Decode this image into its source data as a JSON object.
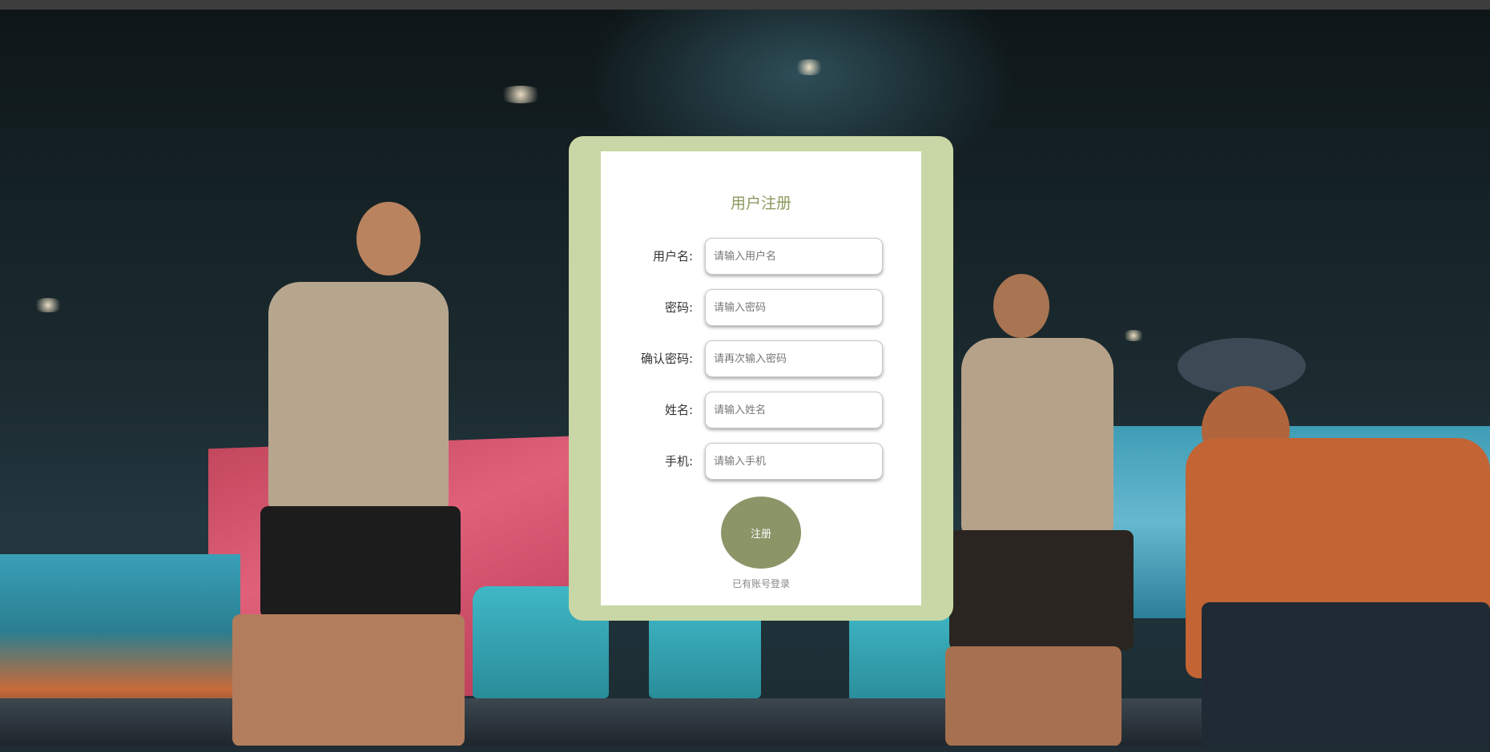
{
  "register": {
    "title": "用户注册",
    "fields": [
      {
        "label": "用户名:",
        "placeholder": "请输入用户名",
        "value": ""
      },
      {
        "label": "密码:",
        "placeholder": "请输入密码",
        "value": ""
      },
      {
        "label": "确认密码:",
        "placeholder": "请再次输入密码",
        "value": ""
      },
      {
        "label": "姓名:",
        "placeholder": "请输入姓名",
        "value": ""
      },
      {
        "label": "手机:",
        "placeholder": "请输入手机",
        "value": ""
      }
    ],
    "submit_label": "注册",
    "login_link": "已有账号登录"
  },
  "colors": {
    "frame": "#c8d7a5",
    "title": "#8a9a5f",
    "button": "#8b9567"
  }
}
